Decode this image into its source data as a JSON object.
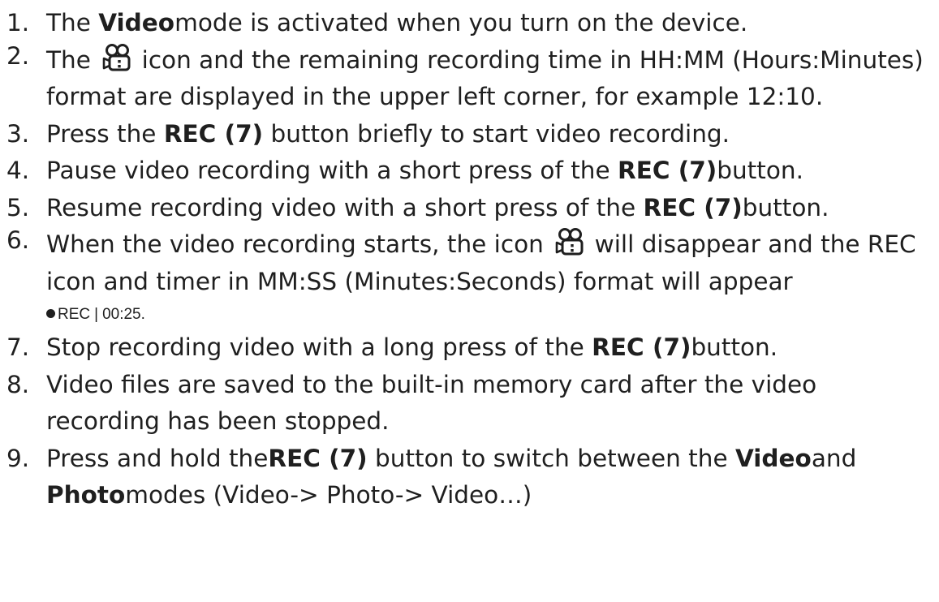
{
  "steps": [
    {
      "num": "1.",
      "parts": [
        "The ",
        "Video",
        "mode is activated when you turn on the device."
      ]
    },
    {
      "num": "2.",
      "before_icon": "The ",
      "after_icon": " icon and the remaining recording time in HH:MM (Hours:Minutes) format are displayed in the upper left corner, for example 12:10."
    },
    {
      "num": "3.",
      "parts": [
        "Press the ",
        "REC (7)",
        " button briefly to start video recording."
      ]
    },
    {
      "num": "4.",
      "parts": [
        "Pause video recording with a short press of the ",
        "REC (7)",
        "button."
      ]
    },
    {
      "num": "5.",
      "parts": [
        "Resume recording video with a short press of the ",
        "REC (7)",
        "button."
      ]
    },
    {
      "num": "6.",
      "before_icon": "When the video recording starts, the icon ",
      "after_icon": " will disappear and the REC icon and timer in MM:SS (Minutes:Seconds) format will appear",
      "rec_label": "REC",
      "rec_sep": "|",
      "rec_time": "00:25",
      "rec_end": "."
    },
    {
      "num": "7.",
      "parts": [
        "Stop recording video with a long press of the ",
        "REC (7)",
        "button."
      ]
    },
    {
      "num": "8.",
      "text": "Video files are saved to the built-in memory card after the video recording has been stopped."
    },
    {
      "num": "9.",
      "parts": [
        "Press and hold the",
        "REC (7)",
        " button to switch between the ",
        "Video",
        "and ",
        "Photo",
        "modes (Video-> Photo-> Video…)"
      ]
    }
  ],
  "icons": {
    "video_mode": "video-camera-icon",
    "rec_dot": "record-dot-icon"
  },
  "colors": {
    "text": "#1f1f1f",
    "background": "#ffffff"
  }
}
